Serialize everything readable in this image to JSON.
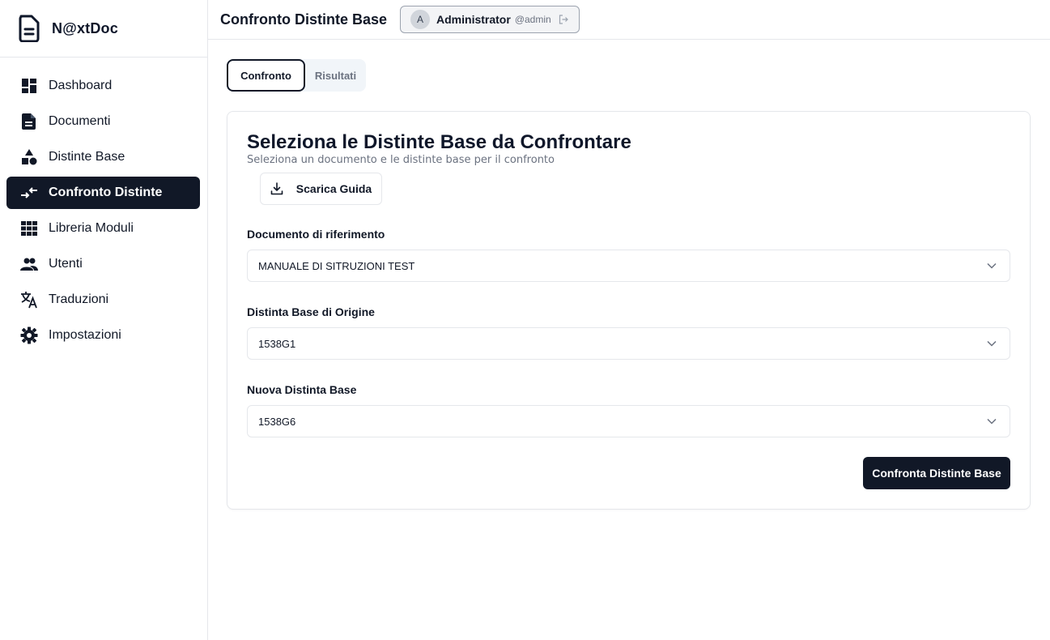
{
  "app": {
    "name": "N@xtDoc"
  },
  "sidebar": {
    "items": [
      {
        "label": "Dashboard",
        "icon": "dashboard-icon",
        "active": false
      },
      {
        "label": "Documenti",
        "icon": "document-icon",
        "active": false
      },
      {
        "label": "Distinte Base",
        "icon": "shapes-icon",
        "active": false
      },
      {
        "label": "Confronto Distinte",
        "icon": "compare-arrows-icon",
        "active": true
      },
      {
        "label": "Libreria Moduli",
        "icon": "grid-icon",
        "active": false
      },
      {
        "label": "Utenti",
        "icon": "users-icon",
        "active": false
      },
      {
        "label": "Traduzioni",
        "icon": "translate-icon",
        "active": false
      },
      {
        "label": "Impostazioni",
        "icon": "gear-icon",
        "active": false
      }
    ]
  },
  "header": {
    "title": "Confronto Distinte Base",
    "user": {
      "initial": "A",
      "name": "Administrator",
      "handle": "@admin"
    }
  },
  "tabs": [
    {
      "label": "Confronto",
      "active": true
    },
    {
      "label": "Risultati",
      "active": false
    }
  ],
  "card": {
    "title": "Seleziona le Distinte Base da Confrontare",
    "subtitle": "Seleziona un documento e le distinte base per il confronto",
    "guide_button": "Scarica Guida",
    "fields": {
      "document": {
        "label": "Documento di riferimento",
        "value": "MANUALE DI SITRUZIONI TEST"
      },
      "origin": {
        "label": "Distinta Base di Origine",
        "value": "1538G1"
      },
      "new": {
        "label": "Nuova Distinta Base",
        "value": "1538G6"
      }
    },
    "submit_button": "Confronta Distinte Base"
  },
  "colors": {
    "accent": "#111827",
    "border": "#e5e7eb",
    "muted": "#6b7280"
  }
}
